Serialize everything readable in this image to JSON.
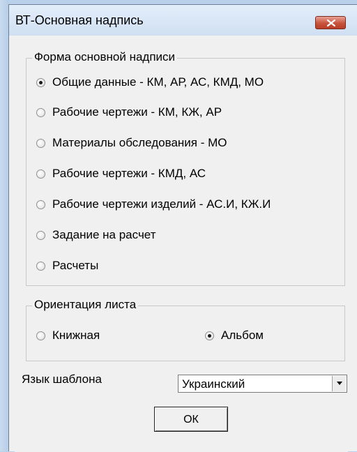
{
  "window": {
    "title": "ВТ-Основная надпись"
  },
  "form_group": {
    "title": "Форма основной надписи",
    "options": [
      {
        "label": "Общие данные - КМ, АР, АС, КМД, МО",
        "checked": true
      },
      {
        "label": "Рабочие чертежи - КМ, КЖ, АР",
        "checked": false
      },
      {
        "label": "Материалы обследования - МО",
        "checked": false
      },
      {
        "label": "Рабочие чертежи - КМД, АС",
        "checked": false
      },
      {
        "label": "Рабочие чертежи изделий - АС.И, КЖ.И",
        "checked": false
      },
      {
        "label": "Задание на расчет",
        "checked": false
      },
      {
        "label": "Расчеты",
        "checked": false
      }
    ]
  },
  "orientation_group": {
    "title": "Ориентация листа",
    "options": [
      {
        "label": "Книжная",
        "checked": false
      },
      {
        "label": "Альбом",
        "checked": true
      }
    ]
  },
  "language": {
    "label": "Язык шаблона",
    "selected": "Украинский"
  },
  "buttons": {
    "ok_label": "ОК"
  },
  "icons": {
    "close": "close-icon",
    "dropdown": "chevron-down-icon"
  },
  "colors": {
    "close_button": "#c8533b",
    "dialog_background": "#f0f0f0"
  }
}
